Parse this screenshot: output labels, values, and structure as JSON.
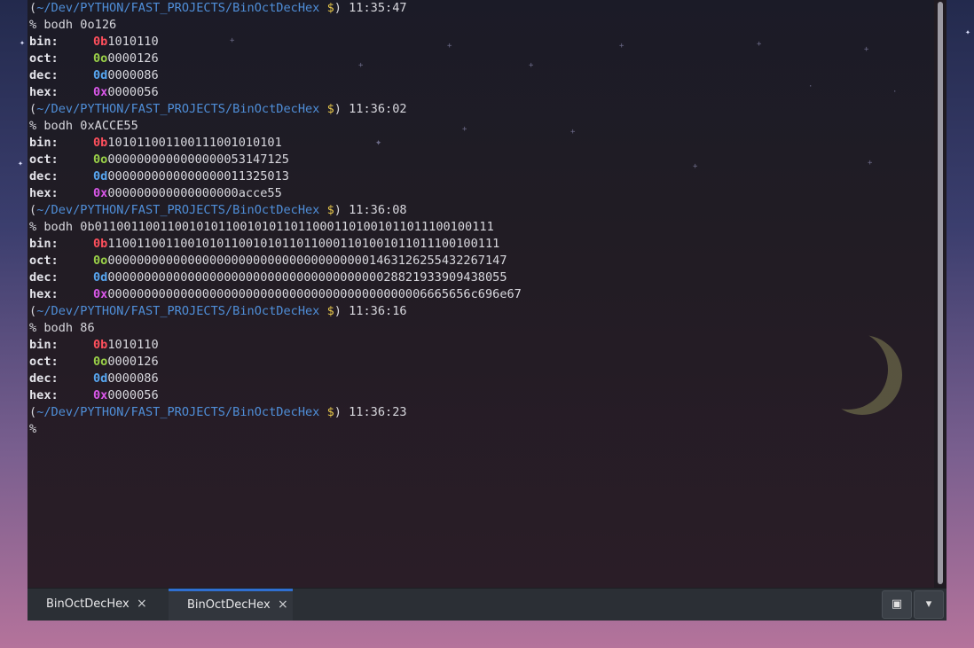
{
  "terminal": {
    "lines": [
      {
        "type": "prompt",
        "path": "~/Dev/PYTHON/FAST_PROJECTS/BinOctDecHex",
        "time": "11:35:47"
      },
      {
        "type": "cmd",
        "text": "bodh 0o126"
      },
      {
        "type": "result",
        "label": "bin:",
        "prefix": "0b",
        "value": "1010110",
        "kind": "b"
      },
      {
        "type": "result",
        "label": "oct:",
        "prefix": "0o",
        "value": "0000126",
        "kind": "o"
      },
      {
        "type": "result",
        "label": "dec:",
        "prefix": "0d",
        "value": "0000086",
        "kind": "d"
      },
      {
        "type": "result",
        "label": "hex:",
        "prefix": "0x",
        "value": "0000056",
        "kind": "x"
      },
      {
        "type": "prompt",
        "path": "~/Dev/PYTHON/FAST_PROJECTS/BinOctDecHex",
        "time": "11:36:02"
      },
      {
        "type": "cmd",
        "text": "bodh 0xACCE55"
      },
      {
        "type": "result",
        "label": "bin:",
        "prefix": "0b",
        "value": "101011001100111001010101",
        "kind": "b"
      },
      {
        "type": "result",
        "label": "oct:",
        "prefix": "0o",
        "value": "0000000000000000053147125",
        "kind": "o"
      },
      {
        "type": "result",
        "label": "dec:",
        "prefix": "0d",
        "value": "0000000000000000011325013",
        "kind": "d"
      },
      {
        "type": "result",
        "label": "hex:",
        "prefix": "0x",
        "value": "000000000000000000acce55",
        "kind": "x"
      },
      {
        "type": "prompt",
        "path": "~/Dev/PYTHON/FAST_PROJECTS/BinOctDecHex",
        "time": "11:36:08"
      },
      {
        "type": "cmd",
        "text": "bodh 0b0110011001100101011001010110110001101001011011100100111"
      },
      {
        "type": "result",
        "label": "bin:",
        "prefix": "0b",
        "value": "110011001100101011001010110110001101001011011100100111",
        "kind": "b"
      },
      {
        "type": "result",
        "label": "oct:",
        "prefix": "0o",
        "value": "0000000000000000000000000000000000001463126255432267147",
        "kind": "o"
      },
      {
        "type": "result",
        "label": "dec:",
        "prefix": "0d",
        "value": "0000000000000000000000000000000000000028821933909438055",
        "kind": "d"
      },
      {
        "type": "result",
        "label": "hex:",
        "prefix": "0x",
        "value": "00000000000000000000000000000000000000000006665656c696e67",
        "kind": "x"
      },
      {
        "type": "prompt",
        "path": "~/Dev/PYTHON/FAST_PROJECTS/BinOctDecHex",
        "time": "11:36:16"
      },
      {
        "type": "cmd",
        "text": "bodh 86"
      },
      {
        "type": "result",
        "label": "bin:",
        "prefix": "0b",
        "value": "1010110",
        "kind": "b"
      },
      {
        "type": "result",
        "label": "oct:",
        "prefix": "0o",
        "value": "0000126",
        "kind": "o"
      },
      {
        "type": "result",
        "label": "dec:",
        "prefix": "0d",
        "value": "0000086",
        "kind": "d"
      },
      {
        "type": "result",
        "label": "hex:",
        "prefix": "0x",
        "value": "0000056",
        "kind": "x"
      },
      {
        "type": "prompt",
        "path": "~/Dev/PYTHON/FAST_PROJECTS/BinOctDecHex",
        "time": "11:36:23"
      },
      {
        "type": "input",
        "text": ""
      }
    ],
    "prompt_symbol": "%",
    "prompt_dollar": "$"
  },
  "tabs": [
    {
      "label": "BinOctDecHex",
      "close": "×",
      "active": false
    },
    {
      "label": "BinOctDecHex",
      "close": "×",
      "active": true
    }
  ],
  "toolbar": {
    "new_tab_icon": "new-tab-icon",
    "menu_icon": "chevron-down-icon",
    "new_tab_glyph": "▣",
    "menu_glyph": "▾"
  },
  "colors": {
    "path": "#4f8ed8",
    "dollar": "#e6c64a",
    "bin_prefix": "#ff4f5c",
    "oct_prefix": "#9ad148",
    "dec_prefix": "#57a6f0",
    "hex_prefix": "#d957e8",
    "active_tab_accent": "#2f6fd1"
  }
}
